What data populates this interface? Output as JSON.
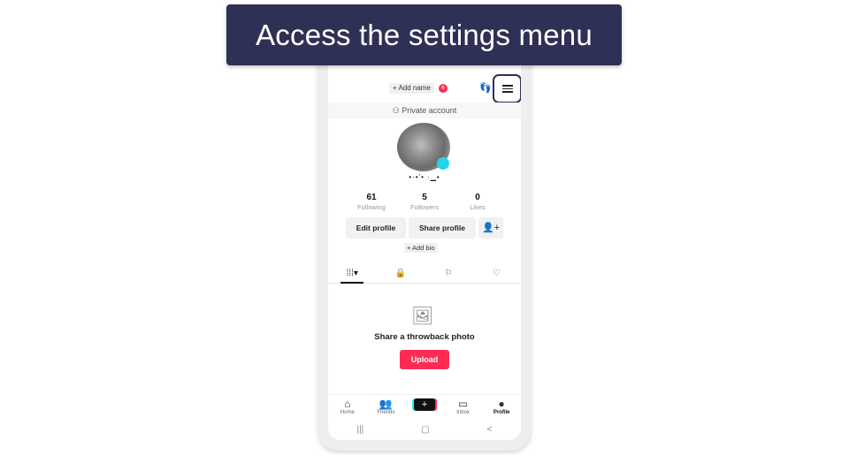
{
  "banner": {
    "title": "Access the settings menu"
  },
  "header": {
    "add_name": "+ Add name",
    "notification_count": "6",
    "private_account": "Private account"
  },
  "profile": {
    "username": "•·•'• ·▁•",
    "stats": [
      {
        "value": "61",
        "label": "Following"
      },
      {
        "value": "5",
        "label": "Followers"
      },
      {
        "value": "0",
        "label": "Likes"
      }
    ],
    "edit_profile": "Edit profile",
    "share_profile": "Share profile",
    "add_bio": "+ Add bio"
  },
  "tabs": [
    {
      "icon": "grid-icon",
      "glyph": "⁞⁞⁞▾"
    },
    {
      "icon": "lock-icon",
      "glyph": "🔒"
    },
    {
      "icon": "repost-icon",
      "glyph": "⚐"
    },
    {
      "icon": "liked-icon",
      "glyph": "♡"
    }
  ],
  "empty_state": {
    "message": "Share a throwback photo",
    "upload_label": "Upload"
  },
  "bottom_nav": [
    {
      "label": "Home",
      "glyph": "⌂"
    },
    {
      "label": "Friends",
      "glyph": "👥"
    },
    {
      "label": "",
      "glyph": "+"
    },
    {
      "label": "Inbox",
      "glyph": "▭"
    },
    {
      "label": "Profile",
      "glyph": "●"
    }
  ],
  "system_nav": {
    "recent": "|||",
    "home": "▢",
    "back": "<"
  },
  "colors": {
    "accent": "#fe2c55",
    "banner": "#2e3055",
    "cyan": "#20d5ec"
  }
}
